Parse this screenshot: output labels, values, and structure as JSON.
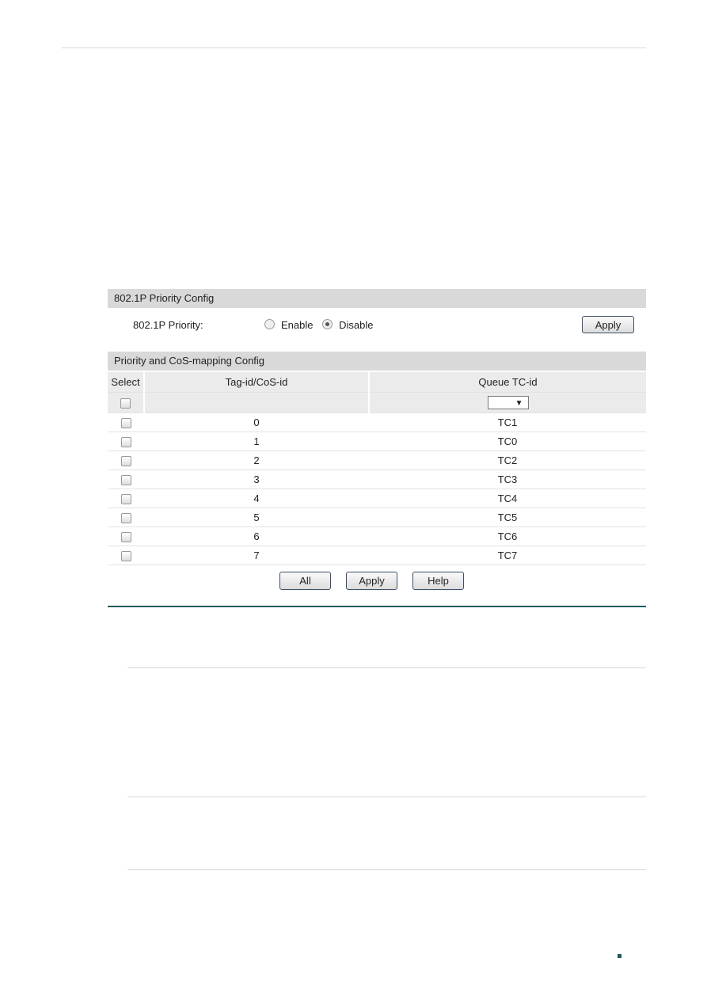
{
  "priority_config": {
    "title": "802.1P Priority Config",
    "label": "802.1P Priority:",
    "options": [
      {
        "label": "Enable",
        "selected": false
      },
      {
        "label": "Disable",
        "selected": true
      }
    ],
    "apply_label": "Apply"
  },
  "mapping_config": {
    "title": "Priority and CoS-mapping Config",
    "columns": [
      "Select",
      "Tag-id/CoS-id",
      "Queue TC-id"
    ],
    "rows": [
      {
        "tag": "0",
        "queue": "TC1"
      },
      {
        "tag": "1",
        "queue": "TC0"
      },
      {
        "tag": "2",
        "queue": "TC2"
      },
      {
        "tag": "3",
        "queue": "TC3"
      },
      {
        "tag": "4",
        "queue": "TC4"
      },
      {
        "tag": "5",
        "queue": "TC5"
      },
      {
        "tag": "6",
        "queue": "TC6"
      },
      {
        "tag": "7",
        "queue": "TC7"
      }
    ],
    "filter_select_icon": "triangle-down-icon"
  },
  "buttons": {
    "all": "All",
    "apply": "Apply",
    "help": "Help"
  },
  "colors": {
    "accent": "#1f5c5c",
    "header_bg": "#d9d9d9"
  }
}
